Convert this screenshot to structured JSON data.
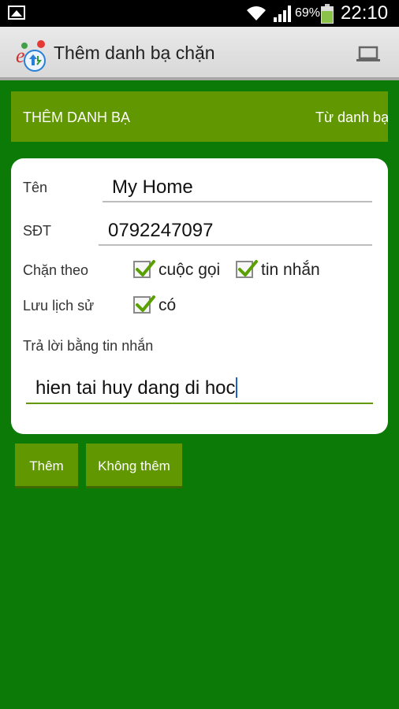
{
  "status_bar": {
    "battery_percent": "69%",
    "time": "22:10",
    "icons": [
      "gallery-icon",
      "wifi-icon",
      "signal-icon",
      "battery-icon"
    ]
  },
  "action_bar": {
    "title": "Thêm danh bạ chặn",
    "icons": [
      "app-logo-icon",
      "laptop-icon"
    ]
  },
  "tabs": {
    "left": "THÊM DANH BẠ",
    "right": "Từ danh bạ"
  },
  "form": {
    "name_label": "Tên",
    "name_value": "My Home",
    "phone_label": "SĐT",
    "phone_value": "0792247097",
    "block_by_label": "Chặn theo",
    "block_calls_label": "cuộc gọi",
    "block_calls_checked": true,
    "block_sms_label": "tin nhắn",
    "block_sms_checked": true,
    "save_history_label": "Lưu lịch sử",
    "save_history_option": "có",
    "save_history_checked": true,
    "reply_label": "Trả lời bằng tin nhắn",
    "reply_value": "hien tai huy dang di hoc"
  },
  "buttons": {
    "add": "Thêm",
    "cancel": "Không thêm"
  },
  "colors": {
    "background": "#0b7a07",
    "accent": "#619700",
    "check": "#5aa000"
  }
}
